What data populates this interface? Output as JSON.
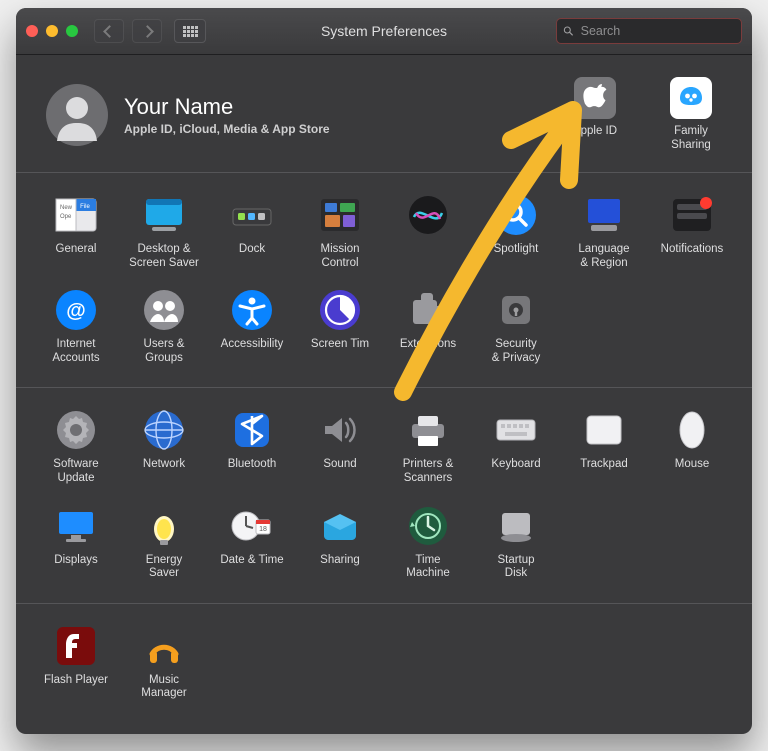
{
  "window": {
    "title": "System Preferences"
  },
  "search": {
    "placeholder": "Search",
    "value": ""
  },
  "account": {
    "name": "Your Name",
    "subtitle": "Apple ID, iCloud, Media & App Store"
  },
  "top_items": {
    "apple_id": "Apple ID",
    "family_sharing": "Family\nSharing"
  },
  "sections": [
    {
      "items": [
        {
          "id": "general",
          "label": "General"
        },
        {
          "id": "desktop",
          "label": "Desktop &\nScreen Saver"
        },
        {
          "id": "dock",
          "label": "Dock"
        },
        {
          "id": "mission",
          "label": "Mission\nControl"
        },
        {
          "id": "siri",
          "label": ""
        },
        {
          "id": "spotlight",
          "label": "Spotlight"
        },
        {
          "id": "language",
          "label": "Language\n& Region"
        },
        {
          "id": "notifications",
          "label": "Notifications"
        },
        {
          "id": "internet",
          "label": "Internet\nAccounts"
        },
        {
          "id": "users",
          "label": "Users &\nGroups"
        },
        {
          "id": "accessibility",
          "label": "Accessibility"
        },
        {
          "id": "screentime",
          "label": "Screen Tim"
        },
        {
          "id": "extensions",
          "label": "Extensions"
        },
        {
          "id": "security",
          "label": "Security\n& Privacy"
        }
      ]
    },
    {
      "items": [
        {
          "id": "software",
          "label": "Software\nUpdate"
        },
        {
          "id": "network",
          "label": "Network"
        },
        {
          "id": "bluetooth",
          "label": "Bluetooth"
        },
        {
          "id": "sound",
          "label": "Sound"
        },
        {
          "id": "printers",
          "label": "Printers &\nScanners"
        },
        {
          "id": "keyboard",
          "label": "Keyboard"
        },
        {
          "id": "trackpad",
          "label": "Trackpad"
        },
        {
          "id": "mouse",
          "label": "Mouse"
        },
        {
          "id": "displays",
          "label": "Displays"
        },
        {
          "id": "energy",
          "label": "Energy\nSaver"
        },
        {
          "id": "datetime",
          "label": "Date & Time"
        },
        {
          "id": "sharing",
          "label": "Sharing"
        },
        {
          "id": "timemachine",
          "label": "Time\nMachine"
        },
        {
          "id": "startup",
          "label": "Startup\nDisk"
        }
      ]
    },
    {
      "items": [
        {
          "id": "flash",
          "label": "Flash Player"
        },
        {
          "id": "music",
          "label": "Music\nManager"
        }
      ]
    }
  ],
  "icon_names": {
    "general": "general-icon",
    "desktop": "desktop-screensaver-icon",
    "dock": "dock-icon",
    "mission": "mission-control-icon",
    "siri": "siri-icon",
    "spotlight": "spotlight-icon",
    "language": "language-region-icon",
    "notifications": "notifications-icon",
    "internet": "internet-accounts-icon",
    "users": "users-groups-icon",
    "accessibility": "accessibility-icon",
    "screentime": "screen-time-icon",
    "extensions": "extensions-icon",
    "security": "security-privacy-icon",
    "software": "software-update-icon",
    "network": "network-icon",
    "bluetooth": "bluetooth-icon",
    "sound": "sound-icon",
    "printers": "printers-scanners-icon",
    "keyboard": "keyboard-icon",
    "trackpad": "trackpad-icon",
    "mouse": "mouse-icon",
    "displays": "displays-icon",
    "energy": "energy-saver-icon",
    "datetime": "date-time-icon",
    "sharing": "sharing-icon",
    "timemachine": "time-machine-icon",
    "startup": "startup-disk-icon",
    "flash": "flash-player-icon",
    "music": "music-manager-icon"
  },
  "colors": {
    "accent_blue": "#0a84ff",
    "accent_orange": "#f5a623"
  }
}
